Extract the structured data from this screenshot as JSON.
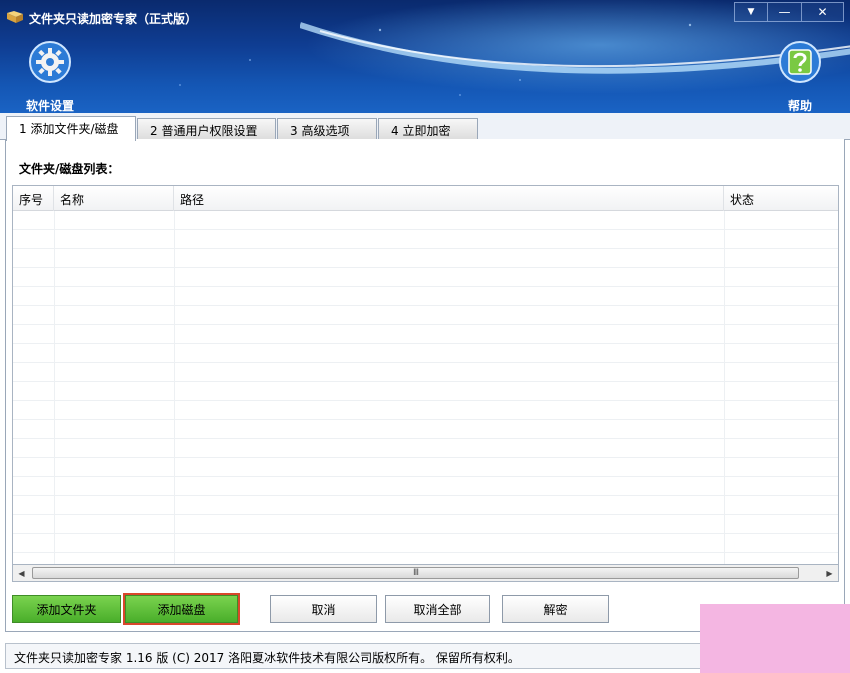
{
  "window": {
    "title": "文件夹只读加密专家（正式版）",
    "controls": [
      "▼",
      "—",
      "✕"
    ]
  },
  "toolbar": {
    "settings_label": "软件设置",
    "help_label": "帮助"
  },
  "tabs": [
    {
      "label": "1 添加文件夹/磁盘",
      "active": true
    },
    {
      "label": "2 普通用户权限设置",
      "active": false
    },
    {
      "label": "3 高级选项",
      "active": false
    },
    {
      "label": "4 立即加密",
      "active": false
    }
  ],
  "list": {
    "label": "文件夹/磁盘列表：",
    "columns": [
      "序号",
      "名称",
      "路径",
      "状态"
    ],
    "rows": []
  },
  "scrollbar": {
    "grip": "III"
  },
  "buttons": {
    "add_folder": "添加文件夹",
    "add_disk": "添加磁盘",
    "cancel": "取消",
    "cancel_all": "取消全部",
    "decrypt": "解密"
  },
  "footer": {
    "copyright": "文件夹只读加密专家 1.16 版 (C) 2017 洛阳夏冰软件技术有限公司版权所有。 保留所有权利。"
  },
  "colors": {
    "header_dark": "#0a2a6e",
    "header_light": "#1a63c4",
    "button_green": "#49ae2a",
    "selection_outline": "#d9472b"
  }
}
